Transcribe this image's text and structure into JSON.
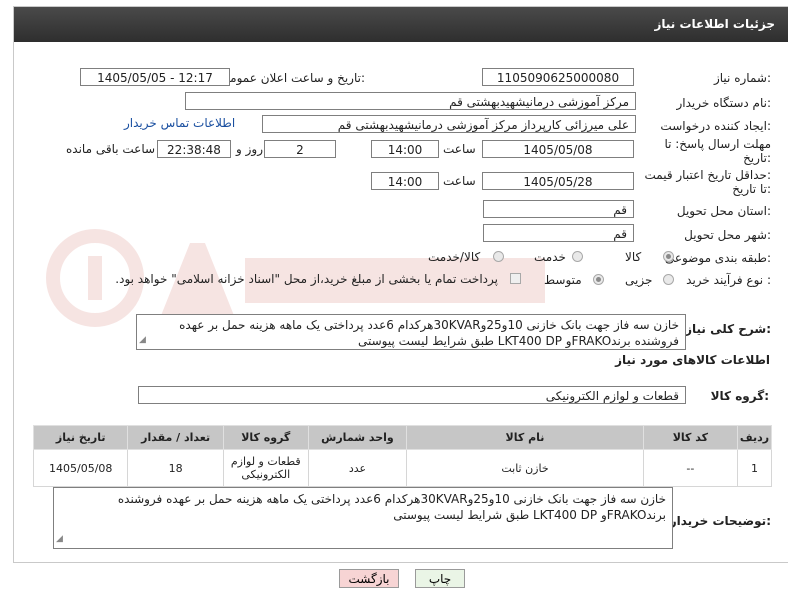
{
  "header": {
    "title": "جزئیات اطلاعات نیاز"
  },
  "form": {
    "need_number_label": "شماره نیاز:",
    "need_number": "1105090625000080",
    "announce_label": "تاریخ و ساعت اعلان عمومی:",
    "announce_value": "1405/05/05 - 12:17",
    "buyer_org_label": "نام دستگاه خریدار:",
    "buyer_org": "مرکز آموزشی درمانیشهیدبهشتی قم",
    "requester_label": "ایجاد کننده درخواست:",
    "requester": "علی میرزائی کارپرداز مرکز آموزشی درمانیشهیدبهشتی قم",
    "contact_link": "اطلاعات تماس خریدار",
    "deadline_label_1": "مهلت ارسال پاسخ: تا",
    "deadline_label_2": "تاریخ:",
    "deadline_date": "1405/05/08",
    "time_label": "ساعت",
    "deadline_time": "14:00",
    "days_value": "2",
    "days_label": "روز و",
    "remaining_time": "22:38:48",
    "remaining_label": "ساعت باقی مانده",
    "validity_label_1": "حداقل تاریخ اعتبار قیمت:",
    "validity_label_2": "تا تاریخ:",
    "validity_date": "1405/05/28",
    "validity_time": "14:00",
    "province_label": "استان محل تحویل:",
    "province": "قم",
    "city_label": "شهر محل تحویل:",
    "city": "قم",
    "category_label": "طبقه بندی موضوعی:",
    "category_options": [
      "کالا",
      "خدمت",
      "کالا/خدمت"
    ],
    "category_selected": "کالا",
    "process_label": "نوع فرآیند خرید :",
    "process_options": [
      "جزیی",
      "متوسط"
    ],
    "process_selected": "متوسط",
    "payment_note": "پرداخت تمام یا بخشی از مبلغ خرید،از محل \"اسناد خزانه اسلامی\" خواهد بود."
  },
  "summary": {
    "label": "شرح کلی نیاز:",
    "text": "خازن سه فاز جهت بانک خازنی 10و25و30KVARهرکدام 6عدد پرداختی یک ماهه هزینه حمل بر عهده فروشنده برندFRAKOو LKT400 DP طبق شرایط لیست پیوستی"
  },
  "goods": {
    "section_title": "اطلاعات کالاهای مورد نیاز",
    "group_label": "گروه کالا:",
    "group_value": "قطعات و لوازم الکترونیکی",
    "columns": [
      "ردیف",
      "کد کالا",
      "نام کالا",
      "واحد شمارش",
      "گروه کالا",
      "تعداد / مقدار",
      "تاریخ نیاز"
    ],
    "rows": [
      {
        "row": "1",
        "code": "--",
        "name": "خازن ثابت",
        "unit": "عدد",
        "group": "قطعات و لوازم الکترونیکی",
        "qty": "18",
        "date": "1405/05/08"
      }
    ]
  },
  "buyer_notes": {
    "label": "توضیحات خریدار:",
    "text": "خازن سه فاز جهت بانک خازنی 10و25و30KVARهرکدام 6عدد پرداختی یک ماهه هزینه حمل بر عهده فروشنده برندFRAKOو LKT400 DP طبق شرایط لیست پیوستی"
  },
  "buttons": {
    "print": "چاپ",
    "back": "بازگشت"
  },
  "colors": {
    "titlebar": "#3a3a3a",
    "table_header": "#c6c6c6",
    "link": "#1a4fa0",
    "back_button": "#f7d4d4",
    "print_button": "#eaf5e6"
  }
}
